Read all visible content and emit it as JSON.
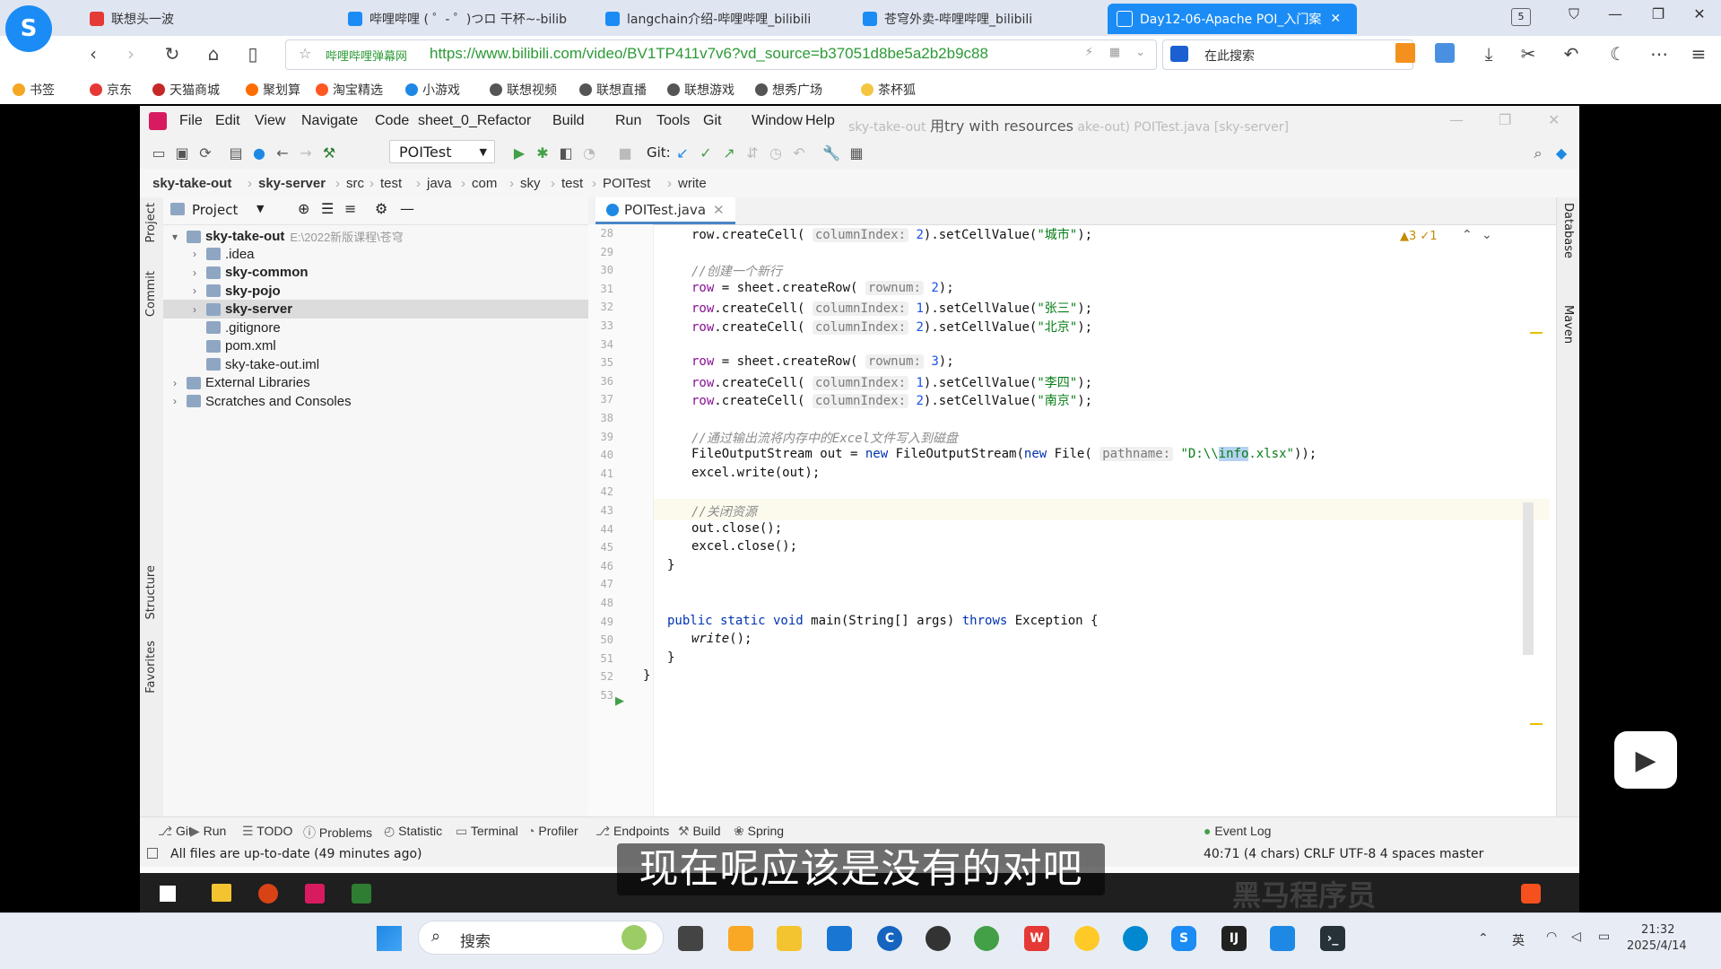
{
  "browser": {
    "logo": "S",
    "tabs": [
      {
        "label": "联想头一波",
        "icon_color": "#e53935"
      },
      {
        "label": "哔哩哔哩 ( ゜- ゜)つロ 干杯~-bilib",
        "icon_color": "#1b8cf5"
      },
      {
        "label": "langchain介绍-哔哩哔哩_bilibili",
        "icon_color": "#1b8cf5"
      },
      {
        "label": "苍穹外卖-哔哩哔哩_bilibili",
        "icon_color": "#1b8cf5"
      },
      {
        "label": "Day12-06-Apache POI_入门案",
        "icon_color": "#ffffff",
        "active": true
      }
    ],
    "tab_count": "5",
    "url_site": "哔哩哔哩弹幕网",
    "url": "https://www.bilibili.com/video/BV1TP411v7v6?vd_source=b37051d8be5a2b2b9c88",
    "search_placeholder": "在此搜索",
    "bookmarks": [
      {
        "label": "书签",
        "color": "#f5a623"
      },
      {
        "label": "京东",
        "color": "#e53935"
      },
      {
        "label": "天猫商城",
        "color": "#c62828"
      },
      {
        "label": "聚划算",
        "color": "#ff6d00"
      },
      {
        "label": "淘宝精选",
        "color": "#ff5722"
      },
      {
        "label": "小游戏",
        "color": "#1e88e5"
      },
      {
        "label": "联想视频",
        "color": "#555555"
      },
      {
        "label": "联想直播",
        "color": "#555555"
      },
      {
        "label": "联想游戏",
        "color": "#555555"
      },
      {
        "label": "想秀广场",
        "color": "#555555"
      },
      {
        "label": "茶杯狐",
        "color": "#f5c542"
      }
    ]
  },
  "ide": {
    "menus": [
      "File",
      "Edit",
      "View",
      "Navigate",
      "Code",
      "sheet_0_Refactor",
      "Build",
      "Run",
      "Tools",
      "Git",
      "Window",
      "Help"
    ],
    "title_faded": "sky-take-out",
    "title_overlay": "用try with resources",
    "title_rest": "ake-out) POITest.java [sky-server]",
    "run_config": "POITest",
    "git_label": "Git:",
    "breadcrumb": [
      "sky-take-out",
      "sky-server",
      "src",
      "test",
      "java",
      "com",
      "sky",
      "test",
      "POITest",
      "write"
    ],
    "project_header": "Project",
    "project_tree": [
      {
        "label": "sky-take-out",
        "suffix": "E:\\2022新版课程\\苍穹",
        "indent": 0,
        "bold": true,
        "arrow": "▾"
      },
      {
        "label": ".idea",
        "indent": 1,
        "arrow": "›"
      },
      {
        "label": "sky-common",
        "indent": 1,
        "bold": true,
        "arrow": "›"
      },
      {
        "label": "sky-pojo",
        "indent": 1,
        "bold": true,
        "arrow": "›"
      },
      {
        "label": "sky-server",
        "indent": 1,
        "bold": true,
        "arrow": "›",
        "selected": true
      },
      {
        "label": ".gitignore",
        "indent": 1,
        "arrow": ""
      },
      {
        "label": "pom.xml",
        "indent": 1,
        "arrow": ""
      },
      {
        "label": "sky-take-out.iml",
        "indent": 1,
        "arrow": ""
      },
      {
        "label": "External Libraries",
        "indent": 0,
        "arrow": "›"
      },
      {
        "label": "Scratches and Consoles",
        "indent": 0,
        "arrow": "›"
      }
    ],
    "left_stripe": [
      "Project",
      "Commit",
      "Structure",
      "Favorites"
    ],
    "right_stripe": [
      "Database",
      "Maven"
    ],
    "file_tab": "POITest.java",
    "inspection": "▲3  ✓1",
    "code_lines": [
      {
        "n": "28",
        "html": "row.createCell( <span class='hint'>columnIndex:</span> <span class='num'>2</span>).setCellValue(<span class='str'>\"城市\"</span>);",
        "indent": 0
      },
      {
        "n": "29",
        "html": "",
        "indent": 0
      },
      {
        "n": "30",
        "html": "<span class='cmt'>//创建一个新行</span>",
        "indent": 0
      },
      {
        "n": "31",
        "html": "<span class='fld'>row</span> = sheet.createRow( <span class='hint'>rownum:</span> <span class='num'>2</span>);",
        "indent": 0
      },
      {
        "n": "32",
        "html": "<span class='fld'>row</span>.createCell( <span class='hint'>columnIndex:</span> <span class='num'>1</span>).setCellValue(<span class='str'>\"张三\"</span>);",
        "indent": 0
      },
      {
        "n": "33",
        "html": "<span class='fld'>row</span>.createCell( <span class='hint'>columnIndex:</span> <span class='num'>2</span>).setCellValue(<span class='str'>\"北京\"</span>);",
        "indent": 0
      },
      {
        "n": "34",
        "html": "",
        "indent": 0
      },
      {
        "n": "35",
        "html": "<span class='fld'>row</span> = sheet.createRow( <span class='hint'>rownum:</span> <span class='num'>3</span>);",
        "indent": 0
      },
      {
        "n": "36",
        "html": "<span class='fld'>row</span>.createCell( <span class='hint'>columnIndex:</span> <span class='num'>1</span>).setCellValue(<span class='str'>\"李四\"</span>);",
        "indent": 0
      },
      {
        "n": "37",
        "html": "<span class='fld'>row</span>.createCell( <span class='hint'>columnIndex:</span> <span class='num'>2</span>).setCellValue(<span class='str'>\"南京\"</span>);",
        "indent": 0
      },
      {
        "n": "38",
        "html": "",
        "indent": 0
      },
      {
        "n": "39",
        "html": "<span class='cmt'>//通过输出流将内存中的Excel文件写入到磁盘</span>",
        "indent": 0
      },
      {
        "n": "40",
        "html": "FileOutputStream out = <span class='kw'>new</span> FileOutputStream(<span class='kw'>new</span> File( <span class='hint'>pathname:</span> <span class='str'>\"D:\\\\<span style='background:#b6d2f2'>info</span>.xlsx\"</span>));",
        "indent": 0
      },
      {
        "n": "41",
        "html": "excel.write(out);",
        "indent": 0
      },
      {
        "n": "42",
        "html": "",
        "indent": 0
      },
      {
        "n": "43",
        "html": "<span class='cmt'>//关闭资源</span>",
        "indent": 0
      },
      {
        "n": "44",
        "html": "out.close();",
        "indent": 0
      },
      {
        "n": "45",
        "html": "excel.close();",
        "indent": 0
      },
      {
        "n": "46",
        "html": "}",
        "indent": -1
      },
      {
        "n": "47",
        "html": "",
        "indent": 0
      },
      {
        "n": "48",
        "html": "",
        "indent": 0
      },
      {
        "n": "49",
        "html": "<span class='kw'>public static void</span> main(String[] args) <span class='kw'>throws</span> Exception {",
        "indent": -1
      },
      {
        "n": "50",
        "html": "<i>write</i>();",
        "indent": 0
      },
      {
        "n": "51",
        "html": "}",
        "indent": -1
      },
      {
        "n": "52",
        "html": "}",
        "indent": -2
      },
      {
        "n": "53",
        "html": "",
        "indent": 0
      }
    ],
    "bottom_tools": [
      "Git",
      "Run",
      "TODO",
      "Problems",
      "Statistic",
      "Terminal",
      "Profiler",
      "Endpoints",
      "Build",
      "Spring",
      "Event Log"
    ],
    "status_left": "All files are up-to-date (49 minutes ago)",
    "status_right": "40:71 (4 chars)   CRLF   UTF-8   4 spaces   master"
  },
  "video": {
    "subtitle": "现在呢应该是没有的对吧",
    "watermark": "黑马程序员"
  },
  "taskbar": {
    "search_placeholder": "搜索",
    "time": "21:32",
    "date": "2025/4/14",
    "ime": "英"
  }
}
